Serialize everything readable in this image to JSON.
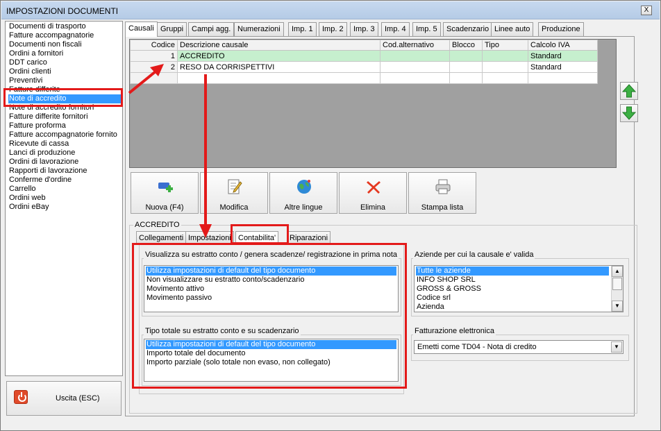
{
  "window": {
    "title": "IMPOSTAZIONI DOCUMENTI",
    "close_glyph": "X"
  },
  "sidebar": {
    "items": [
      "Documenti di trasporto",
      "Fatture accompagnatorie",
      "Documenti non fiscali",
      "Ordini a fornitori",
      "DDT carico",
      "Ordini clienti",
      "Preventivi",
      "Fatture differite",
      "Note di accredito",
      "Note di accredito fornitori",
      "Fatture differite fornitori",
      "Fatture proforma",
      "Fatture accompagnatorie fornito",
      "Ricevute di cassa",
      "Lanci di produzione",
      "Ordini di lavorazione",
      "Rapporti di lavorazione",
      "Conferme d'ordine",
      "Carrello",
      "Ordini web",
      "Ordini eBay"
    ],
    "selected": "Note di accredito"
  },
  "exit_button": {
    "label": "Uscita (ESC)"
  },
  "tabs": [
    "Causali",
    "Gruppi",
    "Campi agg.",
    "Numerazioni",
    "Imp. 1",
    "Imp. 2",
    "Imp. 3",
    "Imp. 4",
    "Imp. 5",
    "Scadenzario",
    "Linee auto",
    "Produzione"
  ],
  "active_tab": "Causali",
  "grid": {
    "columns": [
      "Codice",
      "Descrizione causale",
      "Cod.alternativo",
      "Blocco",
      "Tipo",
      "Calcolo IVA"
    ],
    "rows": [
      {
        "codice": "1",
        "descrizione": "ACCREDITO",
        "cod_alt": "",
        "blocco": "",
        "tipo": "",
        "calcolo_iva": "Standard"
      },
      {
        "codice": "2",
        "descrizione": "RESO DA CORRISPETTIVI",
        "cod_alt": "",
        "blocco": "",
        "tipo": "",
        "calcolo_iva": "Standard"
      }
    ]
  },
  "actions": {
    "new_label": "Nuova (F4)",
    "edit_label": "Modifica",
    "languages_label": "Altre lingue",
    "delete_label": "Elimina",
    "print_label": "Stampa lista"
  },
  "detail": {
    "group_title": "ACCREDITO",
    "subtabs": [
      "Collegamenti",
      "Impostazioni",
      "Contabilita'",
      "Riparazioni"
    ],
    "active_subtab": "Contabilita'",
    "visualizza": {
      "title": "Visualizza su estratto conto / genera scadenze/ registrazione  in prima nota",
      "options": [
        "Utilizza impostazioni di default del tipo documento",
        "Non visualizzare su estratto conto/scadenzario",
        "Movimento attivo",
        "Movimento passivo"
      ],
      "selected": "Utilizza impostazioni di default del tipo documento"
    },
    "tipo_totale": {
      "title": "Tipo totale su estratto conto e su scadenzario",
      "options": [
        "Utilizza impostazioni di default del tipo documento",
        "Importo totale del documento",
        "Importo parziale (solo totale non evaso, non collegato)"
      ],
      "selected": "Utilizza impostazioni di default del tipo documento"
    },
    "aziende": {
      "title": "Aziende per cui la causale e' valida",
      "options": [
        "Tutte le aziende",
        "INFO SHOP SRL",
        "GROSS & GROSS",
        "Codice srl",
        "Azienda"
      ],
      "selected": "Tutte le aziende"
    },
    "fatturazione": {
      "title": "Fatturazione elettronica",
      "value": "Emetti come TD04 - Nota di credito"
    }
  },
  "colors": {
    "selection": "#3399ff",
    "highlight_row": "#c6efce",
    "annotation": "#e31a1a"
  }
}
